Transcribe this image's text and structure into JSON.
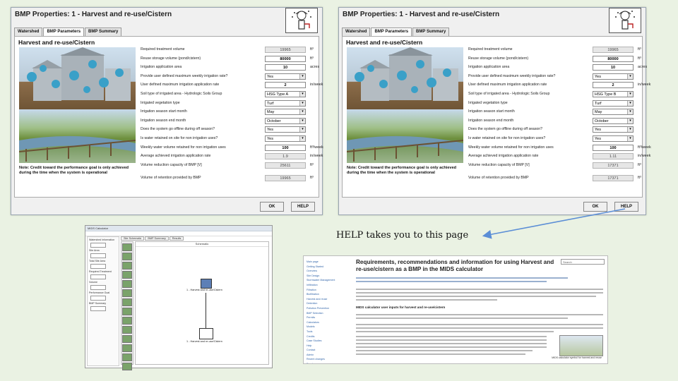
{
  "left_dialog": {
    "title": "BMP Properties: 1 - Harvest and re-use/Cistern",
    "tabs": [
      "Watershed",
      "BMP Parameters",
      "BMP Summary"
    ],
    "panel_heading": "Harvest and re-use/Cistern",
    "note": "Note: Credit toward the performance goal is only achieved during the time when the system is operational",
    "ok_label": "OK",
    "help_label": "HELP",
    "rows": [
      {
        "label": "Required treatment volume",
        "value": "19965",
        "unit": "ft³",
        "kind": "ro"
      },
      {
        "label": "Reuse storage volume (pond/cistern)",
        "value": "80000",
        "unit": "ft³",
        "kind": "edit"
      },
      {
        "label": "Irrigation application area",
        "value": "10",
        "unit": "acres",
        "kind": "edit"
      },
      {
        "label": "Provide user defined maximum weekly irrigation rate?",
        "value": "Yes",
        "unit": "",
        "kind": "sel"
      },
      {
        "label": "User defined maximum irrigation application rate",
        "value": "2",
        "unit": "in/week",
        "kind": "edit"
      },
      {
        "label": "Soil type of irrigated area - Hydrologic Soils Group",
        "value": "HSG Type A",
        "unit": "",
        "kind": "sel"
      },
      {
        "label": "Irrigated vegetation type",
        "value": "Turf",
        "unit": "",
        "kind": "sel"
      },
      {
        "label": "Irrigation season start month",
        "value": "May",
        "unit": "",
        "kind": "sel"
      },
      {
        "label": "Irrigation season end month",
        "value": "October",
        "unit": "",
        "kind": "sel"
      },
      {
        "label": "Does the system go offline during off season?",
        "value": "Yes",
        "unit": "",
        "kind": "sel"
      },
      {
        "label": "Is water retained on site for non irrigation uses?",
        "value": "Yes",
        "unit": "",
        "kind": "sel"
      },
      {
        "label": "Weekly water volume retained for non irrigation uses",
        "value": "100",
        "unit": "ft³/week",
        "kind": "edit"
      },
      {
        "label": "Average achieved irrigation application rate",
        "value": "1.9",
        "unit": "in/week",
        "kind": "ro"
      },
      {
        "label": "Volume reduction capacity of BMP [V]",
        "value": "25611",
        "unit": "ft³",
        "kind": "ro"
      },
      {
        "label": "Volume of retention provided by BMP",
        "value": "19965",
        "unit": "ft³",
        "kind": "ro"
      }
    ]
  },
  "right_dialog": {
    "title": "BMP Properties: 1 - Harvest and re-use/Cistern",
    "tabs": [
      "Watershed",
      "BMP Parameters",
      "BMP Summary"
    ],
    "panel_heading": "Harvest and re-use/Cistern",
    "note": "Note: Credit toward the performance goal is only achieved during the time when the system is operational",
    "ok_label": "OK",
    "help_label": "HELP",
    "rows": [
      {
        "label": "Required treatment volume",
        "value": "19965",
        "unit": "ft³",
        "kind": "ro"
      },
      {
        "label": "Reuse storage volume (pond/cistern)",
        "value": "80000",
        "unit": "ft³",
        "kind": "edit"
      },
      {
        "label": "Irrigation application area",
        "value": "10",
        "unit": "acres",
        "kind": "edit"
      },
      {
        "label": "Provide user defined maximum weekly irrigation rate?",
        "value": "Yes",
        "unit": "",
        "kind": "sel"
      },
      {
        "label": "User defined maximum irrigation application rate",
        "value": "2",
        "unit": "in/week",
        "kind": "edit"
      },
      {
        "label": "Soil type of irrigated area - Hydrologic Soils Group",
        "value": "HSG Type B",
        "unit": "",
        "kind": "sel"
      },
      {
        "label": "Irrigated vegetation type",
        "value": "Turf",
        "unit": "",
        "kind": "sel"
      },
      {
        "label": "Irrigation season start month",
        "value": "May",
        "unit": "",
        "kind": "sel"
      },
      {
        "label": "Irrigation season end month",
        "value": "October",
        "unit": "",
        "kind": "sel"
      },
      {
        "label": "Does the system go offline during off season?",
        "value": "Yes",
        "unit": "",
        "kind": "sel"
      },
      {
        "label": "Is water retained on site for non irrigation uses?",
        "value": "Yes",
        "unit": "",
        "kind": "sel"
      },
      {
        "label": "Weekly water volume retained for non irrigation uses",
        "value": "100",
        "unit": "ft³/week",
        "kind": "edit"
      },
      {
        "label": "Average achieved irrigation application rate",
        "value": "1.11",
        "unit": "in/week",
        "kind": "ro"
      },
      {
        "label": "Volume reduction capacity of BMP [V]",
        "value": "17371",
        "unit": "ft³",
        "kind": "ro"
      },
      {
        "label": "Volume of retention provided by BMP",
        "value": "17371",
        "unit": "ft³",
        "kind": "ro"
      }
    ]
  },
  "caption": "HELP takes you to this page",
  "calculator_app": {
    "window_title": "MIDS Calculator",
    "tabs": [
      "Site Schematic",
      "BMP Summary",
      "Results"
    ],
    "canvas_title": "Schematic",
    "node1_label": "1 - Harvest and re-use/Cistern",
    "node2_label": "1 - Harvest and re-use/Cistern",
    "side_labels": [
      "Watershed Information",
      "Site Area",
      "Total Site Area",
      "Required Treatment",
      "Volume",
      "Performance Goal",
      "BMP Summary"
    ]
  },
  "help_page": {
    "title": "Requirements, recommendations and information for using Harvest and re-use/cistern as a BMP in the MIDS calculator",
    "search_placeholder": "Search",
    "section_heading": "MIDS calculator user inputs for harvest and re-use/cistern",
    "figure_caption": "MIDS calculator symbol for harvest and reuse",
    "nav_items": [
      "Main page",
      "Getting Started",
      "Overview",
      "Site Design",
      "Stormwater Management",
      "Infiltration",
      "Filtration",
      "Biofiltration",
      "Harvest and reuse",
      "Detention",
      "Pollution Prevention",
      "BMP Selection",
      "Permits",
      "Calculators",
      "Models",
      "Tools",
      "Credits",
      "Case Studies",
      "Help",
      "Contact",
      "Admin",
      "Recent changes",
      "Random page",
      "What links here",
      "Special pages",
      "Printable version",
      "Permanent link",
      "Page information"
    ]
  },
  "colors": {
    "background": "#eaf2e3",
    "arrow": "#5b8ed6",
    "link": "#3366aa"
  }
}
